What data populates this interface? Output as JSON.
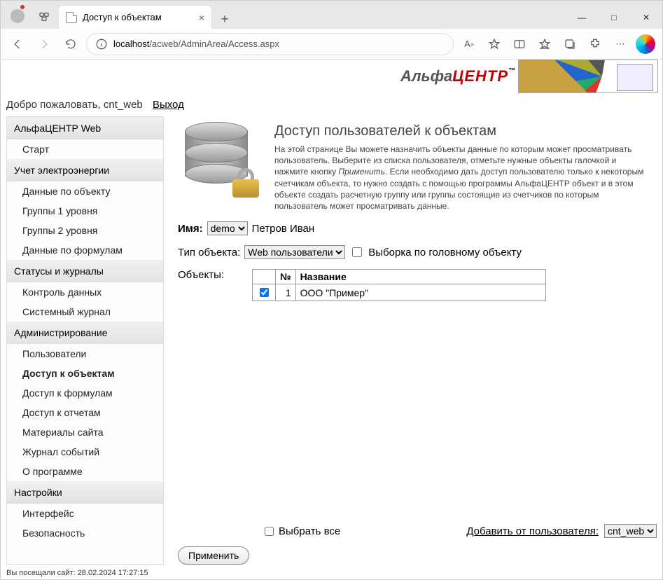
{
  "browser": {
    "tab_title": "Доступ к объектам",
    "url_host": "localhost",
    "url_path": "/acweb/AdminArea/Access.aspx"
  },
  "logo": {
    "part1": "Альфа",
    "part2": "ЦЕНТР",
    "tm": "™"
  },
  "welcome": {
    "text": "Добро пожаловать, cnt_web",
    "logout": "Выход"
  },
  "sidebar": {
    "s1": {
      "title": "АльфаЦЕНТР Web",
      "items": [
        "Старт"
      ]
    },
    "s2": {
      "title": "Учет электроэнергии",
      "items": [
        "Данные по объекту",
        "Группы 1 уровня",
        "Группы 2 уровня",
        "Данные по формулам"
      ]
    },
    "s3": {
      "title": "Статусы и журналы",
      "items": [
        "Контроль данных",
        "Системный журнал"
      ]
    },
    "s4": {
      "title": "Администрирование",
      "items": [
        "Пользователи",
        "Доступ к объектам",
        "Доступ к формулам",
        "Доступ к отчетам",
        "Материалы сайта",
        "Журнал событий",
        "О программе"
      ]
    },
    "s5": {
      "title": "Настройки",
      "items": [
        "Интерфейс",
        "Безопасность"
      ]
    }
  },
  "visit_note": "Вы посещали сайт: 28.02.2024 17:27:15",
  "page": {
    "title": "Доступ пользователей к объектам",
    "desc_a": "На этой странице Вы можете назначить объекты данные по которым может просматривать пользователь. Выберите из списка пользователя, отметьте нужные объекты галочкой и нажмите кнопку ",
    "desc_em": "Применить",
    "desc_b": ". Если необходимо дать доступ пользователю только к некоторым счетчикам объекта, то нужно создать с помощью программы АльфаЦЕНТР объект и в этом объекте создать расчетную группу или группы состоящие из счетчиков по которым пользователь может просматривать данные."
  },
  "form": {
    "name_label": "Имя:",
    "name_select": "demo",
    "name_full": "Петров Иван",
    "type_label": "Тип объекта:",
    "type_select": "Web пользователи",
    "filter_label": "Выборка по головному объекту",
    "objects_label": "Объекты:",
    "select_all": "Выбрать все",
    "add_from_label": "Добавить от пользователя:",
    "add_from_select": "cnt_web",
    "apply": "Применить"
  },
  "table": {
    "col_num": "№",
    "col_name": "Название",
    "rows": [
      {
        "num": "1",
        "name": "ООО \"Пример\"",
        "checked": true
      }
    ]
  }
}
